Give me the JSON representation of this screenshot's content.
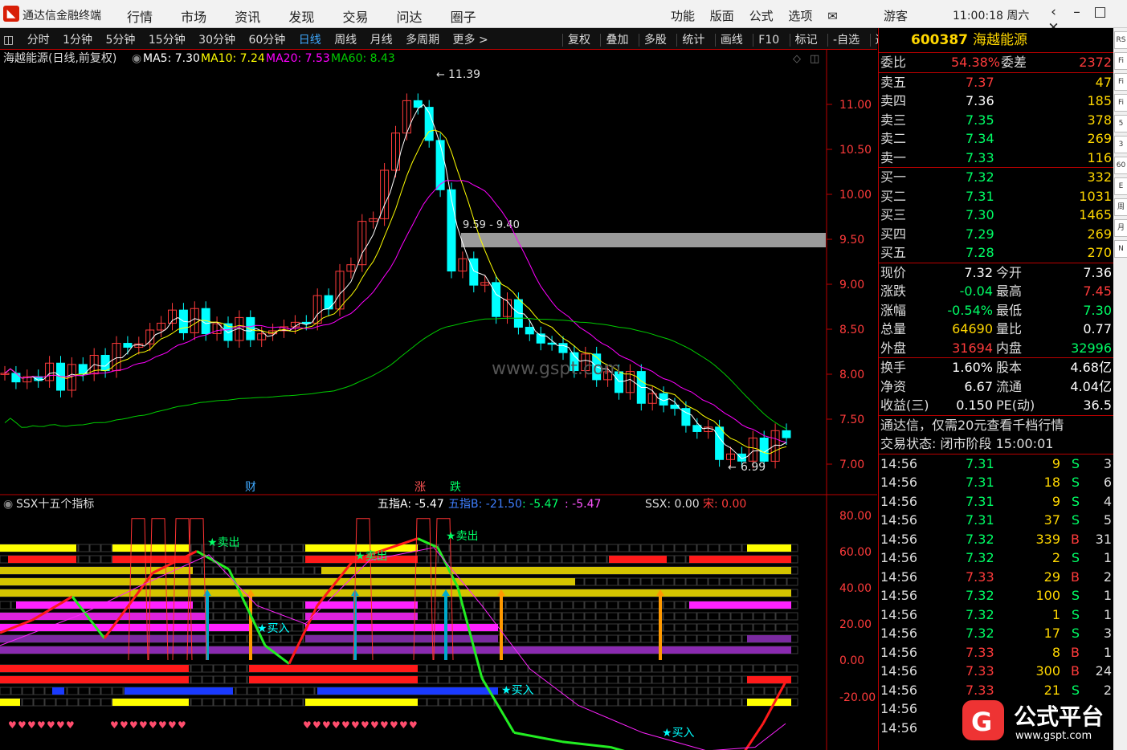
{
  "app": {
    "title": "通达信金融终端",
    "menu": [
      "行情",
      "市场",
      "资讯",
      "发现",
      "交易",
      "问达",
      "圈子"
    ],
    "right_menu": [
      "功能",
      "版面",
      "公式",
      "选项"
    ],
    "mail_icon": "mail-icon",
    "guest": "游客",
    "clock": "11:00:18 周六",
    "window_buttons": [
      "‹",
      "–",
      "□",
      "✕"
    ]
  },
  "periods": [
    "分时",
    "1分钟",
    "5分钟",
    "15分钟",
    "30分钟",
    "60分钟",
    "日线",
    "周线",
    "月线",
    "多周期",
    "更多 >"
  ],
  "active_period": "日线",
  "tools": [
    "复权",
    "叠加",
    "多股",
    "统计",
    "画线",
    "F10",
    "标记",
    "-自选",
    "返回"
  ],
  "main_chart": {
    "title": "海越能源(日线,前复权)",
    "ma5": "MA5: 7.30",
    "ma10": "MA10: 7.24",
    "ma20": "MA20: 7.53",
    "ma60": "MA60: 8.43",
    "high_label": "11.39",
    "low_label": "6.99",
    "zone_label": "9.59 - 9.40",
    "watermark": "www.gspt.com",
    "event_cai": "财",
    "event_zhang": "涨",
    "event_die": "跌",
    "price_ticks": [
      "11.00",
      "10.50",
      "10.00",
      "9.50",
      "9.00",
      "8.50",
      "8.00",
      "7.50",
      "7.00"
    ]
  },
  "indicator": {
    "title": "SSX十五个指标",
    "wuzhiA": "五指A: -5.47",
    "wuzhiB": "五指B: -21.50",
    "val3": ": -5.47",
    "val4": ": -5.47",
    "ssx": "SSX: 0.00",
    "song": "宋: 0.00",
    "ticks": [
      "80.00",
      "60.00",
      "40.00",
      "20.00",
      "0.00",
      "-20.00"
    ],
    "sell_label": "卖出",
    "buy_label": "买入"
  },
  "colors": {
    "up": "#ff3b3b",
    "down": "#00ffff",
    "ma5": "#ffffff",
    "ma10": "#ffff00",
    "ma20": "#ff00ff",
    "ma60": "#00cc00",
    "price_text": "#ff3b3b"
  },
  "stock": {
    "code": "600387",
    "name": "海越能源",
    "weibi_label": "委比",
    "weibi": "54.38%",
    "weicha_label": "委差",
    "weicha": "2372",
    "asks": [
      {
        "label": "卖五",
        "price": "7.37",
        "vol": "47"
      },
      {
        "label": "卖四",
        "price": "7.36",
        "vol": "185"
      },
      {
        "label": "卖三",
        "price": "7.35",
        "vol": "378"
      },
      {
        "label": "卖二",
        "price": "7.34",
        "vol": "269"
      },
      {
        "label": "卖一",
        "price": "7.33",
        "vol": "116"
      }
    ],
    "bids": [
      {
        "label": "买一",
        "price": "7.32",
        "vol": "332"
      },
      {
        "label": "买二",
        "price": "7.31",
        "vol": "1031"
      },
      {
        "label": "买三",
        "price": "7.30",
        "vol": "1465"
      },
      {
        "label": "买四",
        "price": "7.29",
        "vol": "269"
      },
      {
        "label": "买五",
        "price": "7.28",
        "vol": "270"
      }
    ],
    "stats": [
      {
        "l1": "现价",
        "v1": "7.32",
        "l2": "今开",
        "v2": "7.36"
      },
      {
        "l1": "涨跌",
        "v1": "-0.04",
        "l2": "最高",
        "v2": "7.45"
      },
      {
        "l1": "涨幅",
        "v1": "-0.54%",
        "l2": "最低",
        "v2": "7.30"
      },
      {
        "l1": "总量",
        "v1": "64690",
        "l2": "量比",
        "v2": "0.77"
      },
      {
        "l1": "外盘",
        "v1": "31694",
        "l2": "内盘",
        "v2": "32996"
      }
    ],
    "stats2": [
      {
        "l1": "换手",
        "v1": "1.60%",
        "l2": "股本",
        "v2": "4.68亿"
      },
      {
        "l1": "净资",
        "v1": "6.67",
        "l2": "流通",
        "v2": "4.04亿"
      },
      {
        "l1": "收益(三)",
        "v1": "0.150",
        "l2": "PE(动)",
        "v2": "36.5"
      }
    ],
    "promo": "通达信，仅需20元查看千档行情",
    "status": "交易状态: 闭市阶段 15:00:01",
    "ticks": [
      {
        "t": "14:56",
        "p": "7.31",
        "v": "9",
        "bs": "S",
        "n": "3"
      },
      {
        "t": "14:56",
        "p": "7.31",
        "v": "18",
        "bs": "S",
        "n": "6"
      },
      {
        "t": "14:56",
        "p": "7.31",
        "v": "9",
        "bs": "S",
        "n": "4"
      },
      {
        "t": "14:56",
        "p": "7.31",
        "v": "37",
        "bs": "S",
        "n": "5"
      },
      {
        "t": "14:56",
        "p": "7.32",
        "v": "339",
        "bs": "B",
        "n": "31"
      },
      {
        "t": "14:56",
        "p": "7.32",
        "v": "2",
        "bs": "S",
        "n": "1"
      },
      {
        "t": "14:56",
        "p": "7.33",
        "v": "29",
        "bs": "B",
        "n": "2"
      },
      {
        "t": "14:56",
        "p": "7.32",
        "v": "100",
        "bs": "S",
        "n": "1"
      },
      {
        "t": "14:56",
        "p": "7.32",
        "v": "1",
        "bs": "S",
        "n": "1"
      },
      {
        "t": "14:56",
        "p": "7.32",
        "v": "17",
        "bs": "S",
        "n": "3"
      },
      {
        "t": "14:56",
        "p": "7.33",
        "v": "8",
        "bs": "B",
        "n": "1"
      },
      {
        "t": "14:56",
        "p": "7.33",
        "v": "300",
        "bs": "B",
        "n": "24"
      },
      {
        "t": "14:56",
        "p": "7.33",
        "v": "21",
        "bs": "S",
        "n": "2"
      },
      {
        "t": "14:56",
        "p": "",
        "v": "",
        "bs": "",
        "n": ""
      },
      {
        "t": "14:56",
        "p": "",
        "v": "",
        "bs": "",
        "n": ""
      }
    ]
  },
  "side_tabs": [
    "RS",
    "Fi",
    "Fi",
    "Fi",
    "5",
    "3",
    "60",
    "E",
    "周",
    "月",
    "N"
  ],
  "site_watermark": {
    "text": "公式平台",
    "url": "www.gspt.com"
  }
}
